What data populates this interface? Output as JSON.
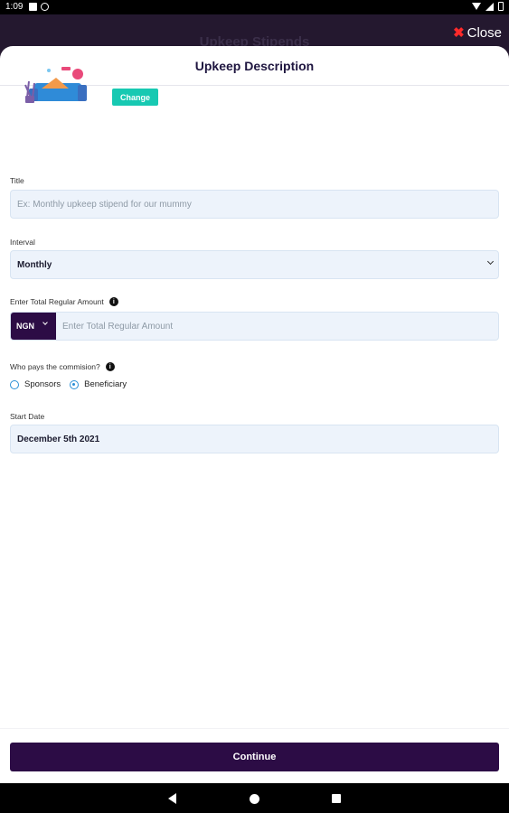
{
  "status_bar": {
    "time": "1:09"
  },
  "top_bar": {
    "title": "Upkeep Stipends",
    "close_label": "Close"
  },
  "sheet": {
    "title": "Upkeep Description"
  },
  "image": {
    "change_label": "Change"
  },
  "title_field": {
    "label": "Title",
    "placeholder": "Ex: Monthly upkeep stipend for our mummy"
  },
  "interval_field": {
    "label": "Interval",
    "value": "Monthly"
  },
  "amount_field": {
    "label": "Enter Total Regular Amount",
    "currency": "NGN",
    "placeholder": "Enter Total Regular Amount"
  },
  "commission": {
    "label": "Who pays the commision?",
    "options": [
      {
        "label": "Sponsors",
        "selected": false
      },
      {
        "label": "Beneficiary",
        "selected": true
      }
    ]
  },
  "start_date_field": {
    "label": "Start Date",
    "value": "December 5th 2021"
  },
  "footer": {
    "continue_label": "Continue"
  },
  "colors": {
    "primary": "#2c0c45",
    "accent": "#17c9b2",
    "close_icon": "#ff2a2a",
    "radio": "#2a8fd6"
  }
}
